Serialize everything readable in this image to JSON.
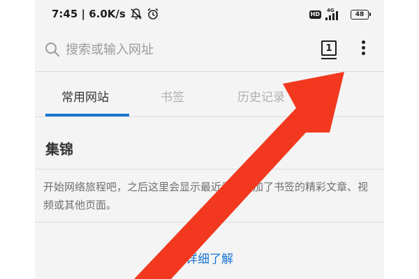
{
  "status_bar": {
    "time_speed": "7:45 | 6.0K/s",
    "hd": "HD",
    "network": "4G",
    "battery": "48"
  },
  "search": {
    "placeholder": "搜索或输入网址",
    "tab_count": "1"
  },
  "tabs": [
    {
      "label": "常用网站",
      "active": true
    },
    {
      "label": "书签",
      "active": false
    },
    {
      "label": "历史记录",
      "active": false
    }
  ],
  "section": {
    "title": "集锦",
    "description": "开始网络旅程吧，之后这里会显示最近看过或加了书签的精彩文章、视频或其他页面。",
    "learn_more": "详细了解"
  },
  "colors": {
    "accent": "#1976d2",
    "arrow": "#f2391f",
    "background": "#f4f4f4"
  },
  "icons": [
    "search-icon",
    "mute-icon",
    "alarm-icon",
    "signal-icon",
    "battery-icon",
    "more-vertical-icon"
  ]
}
